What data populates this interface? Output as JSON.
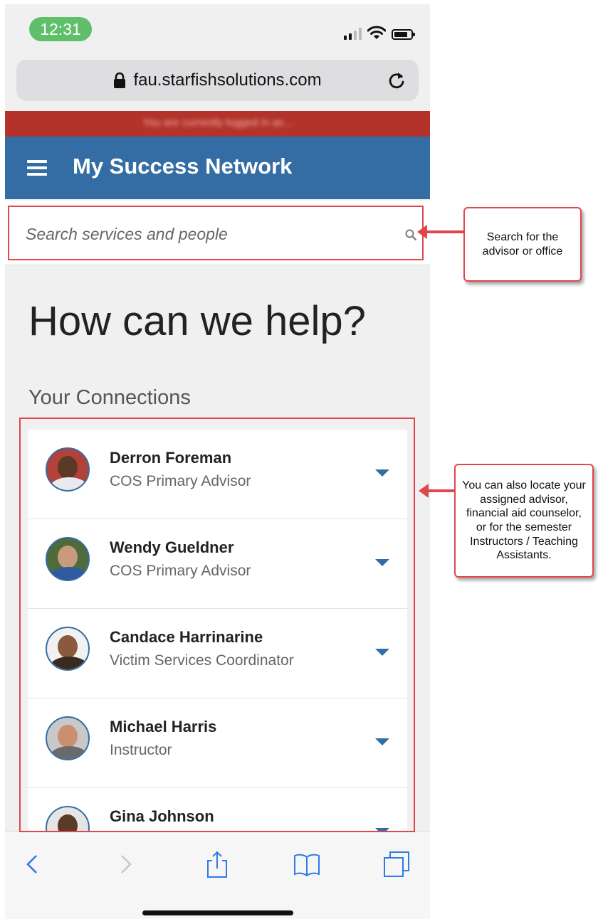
{
  "status_bar": {
    "time": "12:31"
  },
  "browser": {
    "url": "fau.starfishsolutions.com"
  },
  "banner": {
    "text": "You are currently logged in as..."
  },
  "header": {
    "title": "My Success Network"
  },
  "search": {
    "placeholder": "Search services and people"
  },
  "main": {
    "heading": "How can we help?",
    "connections_heading": "Your Connections",
    "connections": [
      {
        "name": "Derron Foreman",
        "role": "COS Primary Advisor"
      },
      {
        "name": "Wendy Gueldner",
        "role": "COS Primary Advisor"
      },
      {
        "name": "Candace Harrinarine",
        "role": "Victim Services Coordinator"
      },
      {
        "name": "Michael Harris",
        "role": "Instructor"
      },
      {
        "name": "Gina Johnson",
        "role": ""
      }
    ]
  },
  "annotations": {
    "search_callout": "Search for the advisor or office",
    "connections_callout": "You can also locate your assigned advisor, financial aid counselor, or for the semester Instructors / Teaching Assistants."
  },
  "colors": {
    "header": "#346da4",
    "banner": "#b3322a",
    "annotation": "#e0474a",
    "time_pill": "#5fbf6a"
  }
}
